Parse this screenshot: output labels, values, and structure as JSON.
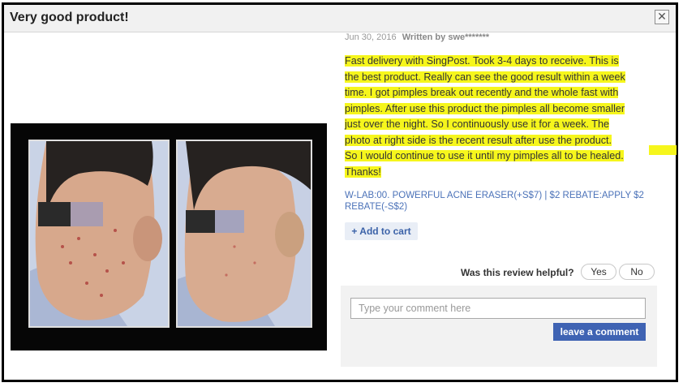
{
  "dialog": {
    "title": "Very good product!",
    "close_label": "✕"
  },
  "review": {
    "date": "Jun 30, 2016",
    "author": "Written by swe*******",
    "lines": [
      "Fast delivery with SingPost. Took 3-4 days to receive. This is",
      "the best product. Really can see the good result within a week",
      "time. I got pimples break out recently and the whole fast with",
      "pimples. After use this product the pimples all become smaller",
      "just over the night. So I continuously use it for a week. The",
      "photo at right side is the recent result after use the product.",
      "So I would continue to use it until my pimples all to be healed.",
      "Thanks!"
    ],
    "highlight_color": "#f6f61c",
    "variant": "W-LAB:00. POWERFUL ACNE ERASER(+S$7) | $2 REBATE:APPLY $2 REBATE(-S$2)",
    "add_to_cart": "+ Add to cart"
  },
  "helpful": {
    "question": "Was this review helpful?",
    "yes": "Yes",
    "no": "No"
  },
  "comment": {
    "placeholder": "Type your comment here",
    "submit": "leave a comment"
  },
  "colors": {
    "link": "#4b72b8",
    "primary_button": "#3f63b3"
  }
}
